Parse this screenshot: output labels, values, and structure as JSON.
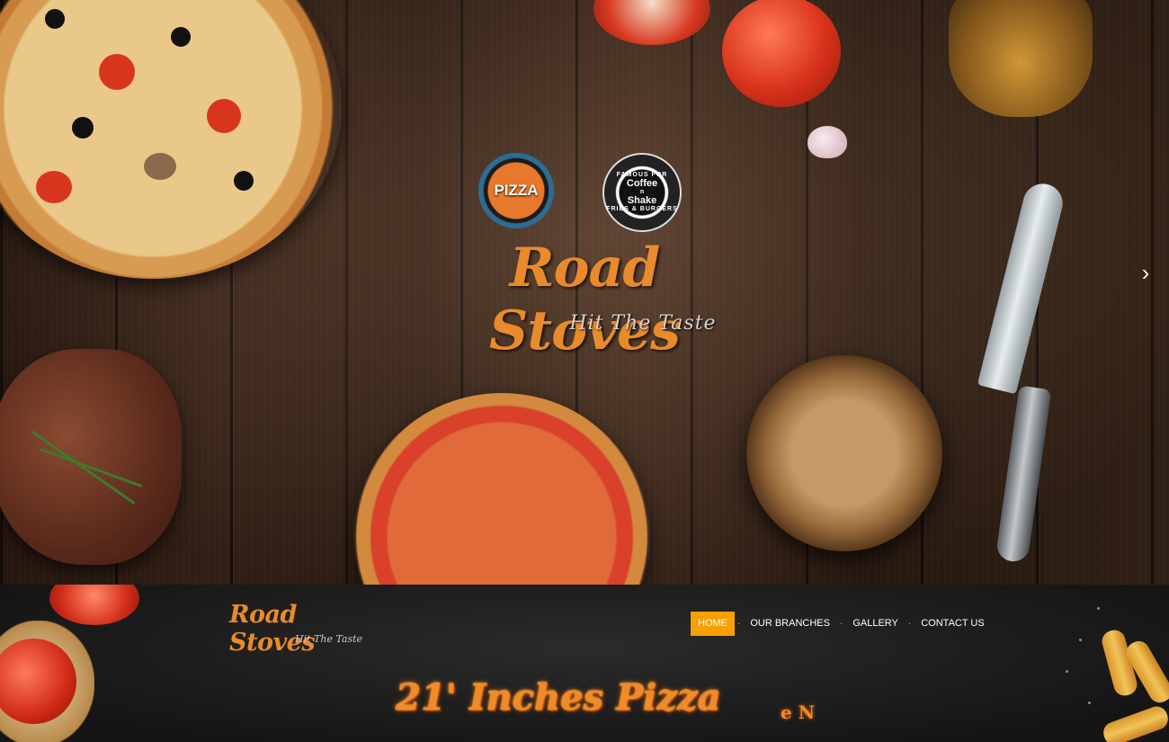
{
  "hero": {
    "badge_pizza": "PIZZA",
    "badge_coffee_line1": "Coffee",
    "badge_coffee_line2": "n",
    "badge_coffee_line3": "Shake",
    "badge_coffee_ring_top": "FAMOUS FOR",
    "badge_coffee_ring_bottom": "FRIES & BURGERS",
    "brand_title": "Road Stoves",
    "brand_tagline": "Hit The Taste",
    "next_icon": "chevron-right-icon"
  },
  "header": {
    "logo_title": "Road Stoves",
    "logo_tagline": "Hit The Taste",
    "nav": [
      {
        "label": "HOME",
        "active": true
      },
      {
        "label": "OUR BRANCHES",
        "active": false
      },
      {
        "label": "GALLERY",
        "active": false
      },
      {
        "label": "CONTACT US",
        "active": false
      }
    ]
  },
  "banner": {
    "headline": "21' Inches Pizza",
    "marquee_fragment": "e N"
  },
  "colors": {
    "accent": "#f5a000",
    "brand_orange": "#e98a2c",
    "nav_text": "#ffffff"
  }
}
